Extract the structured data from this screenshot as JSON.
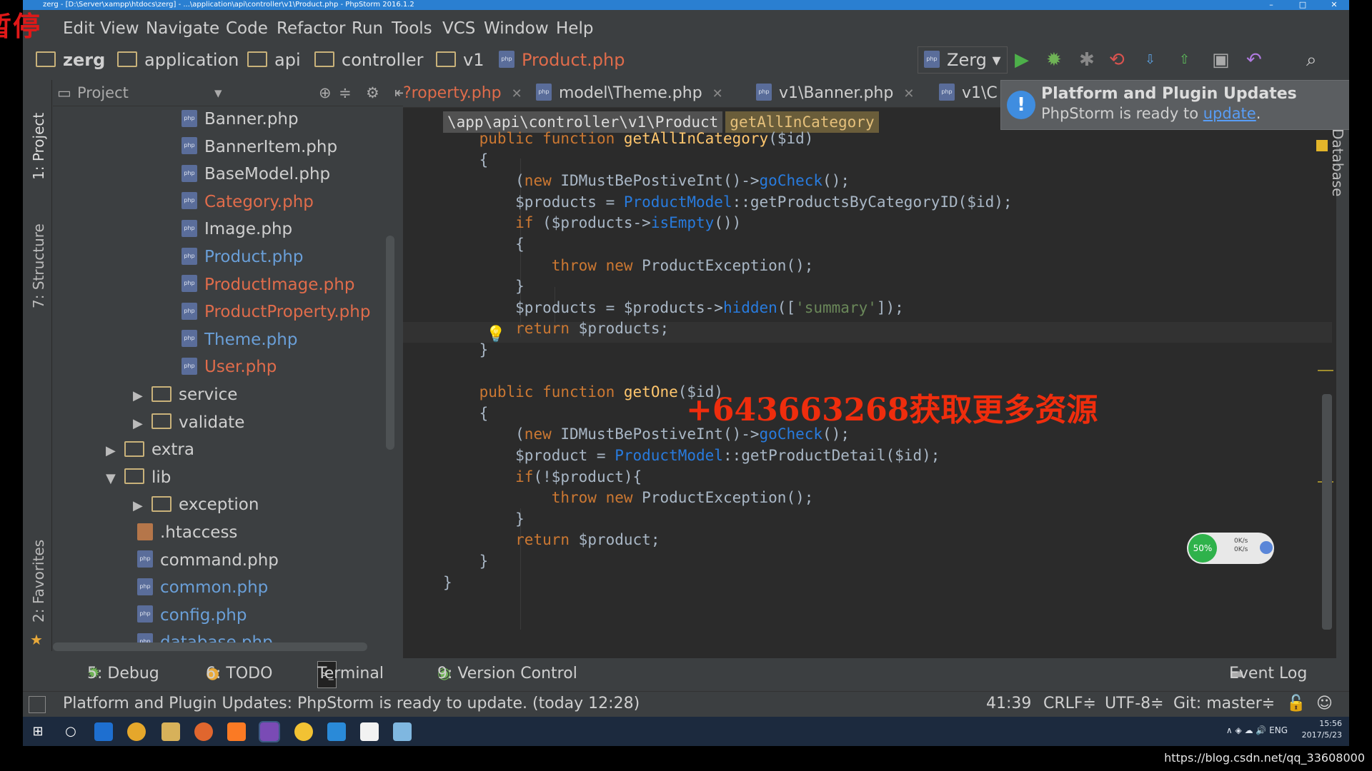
{
  "overlay": {
    "pause_label": "暂停",
    "watermark_text": "+643663268获取更多资源",
    "source_url": "https://blog.csdn.net/qq_33608000"
  },
  "window": {
    "title": "zerg - [D:\\Server\\xampp\\htdocs\\zerg] - ...\\application\\api\\controller\\v1\\Product.php - PhpStorm 2016.1.2",
    "controls": [
      "–",
      "□",
      "✕"
    ]
  },
  "menu": [
    "Edit",
    "View",
    "Navigate",
    "Code",
    "Refactor",
    "Run",
    "Tools",
    "VCS",
    "Window",
    "Help"
  ],
  "navbar": {
    "crumbs": [
      "zerg",
      "application",
      "api",
      "controller",
      "v1",
      "Product.php"
    ],
    "run_config": "Zerg"
  },
  "left_tools": [
    "1: Project",
    "7: Structure",
    "2: Favorites"
  ],
  "right_tools": [
    "Database"
  ],
  "project_panel": {
    "title": "Project",
    "tree": [
      {
        "label": "Banner.php",
        "type": "php",
        "color": "#cfcfcf"
      },
      {
        "label": "BannerItem.php",
        "type": "php",
        "color": "#cfcfcf"
      },
      {
        "label": "BaseModel.php",
        "type": "php",
        "color": "#cfcfcf"
      },
      {
        "label": "Category.php",
        "type": "php",
        "color": "#e06c4b"
      },
      {
        "label": "Image.php",
        "type": "php",
        "color": "#cfcfcf"
      },
      {
        "label": "Product.php",
        "type": "php",
        "color": "#6a9fd8"
      },
      {
        "label": "ProductImage.php",
        "type": "php",
        "color": "#e06c4b"
      },
      {
        "label": "ProductProperty.php",
        "type": "php",
        "color": "#e06c4b"
      },
      {
        "label": "Theme.php",
        "type": "php",
        "color": "#6a9fd8"
      },
      {
        "label": "User.php",
        "type": "php",
        "color": "#e06c4b"
      },
      {
        "label": "service",
        "type": "folder",
        "arrow": "▶",
        "color": "#cfcfcf"
      },
      {
        "label": "validate",
        "type": "folder",
        "arrow": "▶",
        "color": "#cfcfcf"
      },
      {
        "label": "extra",
        "type": "folder",
        "arrow": "▶",
        "color": "#cfcfcf"
      },
      {
        "label": "lib",
        "type": "folder",
        "arrow": "▼",
        "color": "#cfcfcf"
      },
      {
        "label": "exception",
        "type": "folder",
        "arrow": "▶",
        "color": "#cfcfcf"
      },
      {
        "label": ".htaccess",
        "type": "file",
        "color": "#cfcfcf"
      },
      {
        "label": "command.php",
        "type": "php",
        "color": "#cfcfcf"
      },
      {
        "label": "common.php",
        "type": "php",
        "color": "#6a9fd8"
      },
      {
        "label": "config.php",
        "type": "php",
        "color": "#6a9fd8"
      },
      {
        "label": "database.php",
        "type": "php",
        "color": "#6a9fd8"
      }
    ]
  },
  "editor": {
    "tabs": [
      "?roperty.php",
      "model\\Theme.php",
      "v1\\Banner.php",
      "v1\\C"
    ],
    "breadcrumb": [
      "\\app\\api\\controller\\v1\\Product",
      "getAllInCategory"
    ]
  },
  "code_lines": [
    [
      {
        "t": "    "
      },
      {
        "t": "public ",
        "c": "kw"
      },
      {
        "t": "function ",
        "c": "kw"
      },
      {
        "t": "getAllInCategory",
        "c": "fn"
      },
      {
        "t": "($id)"
      }
    ],
    [
      {
        "t": "    {"
      }
    ],
    [
      {
        "t": "        (",
        "c": "var"
      },
      {
        "t": "new ",
        "c": "kw"
      },
      {
        "t": "IDMustBePostiveInt()->"
      },
      {
        "t": "goCheck",
        "c": "mt"
      },
      {
        "t": "();"
      }
    ],
    [
      {
        "t": "        $products = "
      },
      {
        "t": "ProductModel",
        "c": "mt"
      },
      {
        "t": "::getProductsByCategoryID($id);"
      }
    ],
    [
      {
        "t": "        "
      },
      {
        "t": "if ",
        "c": "kw"
      },
      {
        "t": "($products->"
      },
      {
        "t": "isEmpty",
        "c": "mt"
      },
      {
        "t": "())"
      }
    ],
    [
      {
        "t": "        {"
      }
    ],
    [
      {
        "t": "            "
      },
      {
        "t": "throw ",
        "c": "kw"
      },
      {
        "t": "new ",
        "c": "kw"
      },
      {
        "t": "ProductException();"
      }
    ],
    [
      {
        "t": "        }"
      }
    ],
    [
      {
        "t": "        $products = $products->"
      },
      {
        "t": "hidden",
        "c": "mt"
      },
      {
        "t": "(["
      },
      {
        "t": "'summary'",
        "c": "str"
      },
      {
        "t": "]);"
      }
    ],
    [
      {
        "t": "        "
      },
      {
        "t": "return ",
        "c": "kw"
      },
      {
        "t": "$products;"
      }
    ],
    [
      {
        "t": "    }"
      }
    ],
    [
      {
        "t": ""
      }
    ],
    [
      {
        "t": "    "
      },
      {
        "t": "public ",
        "c": "kw"
      },
      {
        "t": "function ",
        "c": "kw"
      },
      {
        "t": "getOne",
        "c": "fn"
      },
      {
        "t": "($id)"
      }
    ],
    [
      {
        "t": "    {"
      }
    ],
    [
      {
        "t": "        ("
      },
      {
        "t": "new ",
        "c": "kw"
      },
      {
        "t": "IDMustBePostiveInt()->"
      },
      {
        "t": "goCheck",
        "c": "mt"
      },
      {
        "t": "();"
      }
    ],
    [
      {
        "t": "        $product = "
      },
      {
        "t": "ProductModel",
        "c": "mt"
      },
      {
        "t": "::getProductDetail($id);"
      }
    ],
    [
      {
        "t": "        "
      },
      {
        "t": "if",
        "c": "kw"
      },
      {
        "t": "(!$product){"
      }
    ],
    [
      {
        "t": "            "
      },
      {
        "t": "throw ",
        "c": "kw"
      },
      {
        "t": "new ",
        "c": "kw"
      },
      {
        "t": "ProductException();"
      }
    ],
    [
      {
        "t": "        }"
      }
    ],
    [
      {
        "t": "        "
      },
      {
        "t": "return ",
        "c": "kw"
      },
      {
        "t": "$product;"
      }
    ],
    [
      {
        "t": "    }"
      }
    ],
    [
      {
        "t": "}"
      }
    ]
  ],
  "notification": {
    "title": "Platform and Plugin Updates",
    "message": "PhpStorm is ready to ",
    "link": "update",
    "suffix": "."
  },
  "net_widget": {
    "percent": "50%",
    "up": "0K/s",
    "down": "0K/s"
  },
  "bottom_tools": [
    "5: Debug",
    "6: TODO",
    "Terminal",
    "9: Version Control",
    "Event Log"
  ],
  "status": {
    "message": "Platform and Plugin Updates: PhpStorm is ready to update. (today 12:28)",
    "position": "41:39",
    "line_sep": "CRLF≑",
    "encoding": "UTF-8≑",
    "vcs": "Git: master≑"
  },
  "taskbar": {
    "lang": "ENG",
    "time": "15:56",
    "date": "2017/5/23"
  }
}
